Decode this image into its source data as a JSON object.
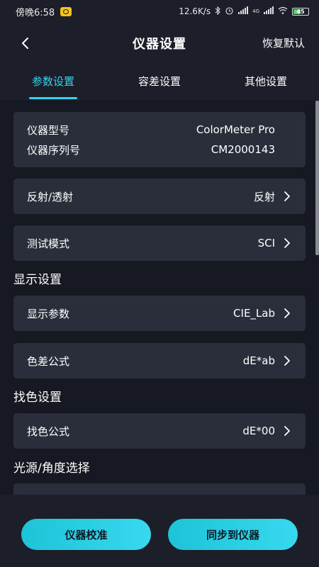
{
  "status_bar": {
    "time": "傍晚6:58",
    "net_speed": "12.6K/s",
    "network": "4G",
    "battery": "45"
  },
  "header": {
    "title": "仪器设置",
    "restore": "恢复默认"
  },
  "tabs": [
    {
      "label": "参数设置",
      "active": true
    },
    {
      "label": "容差设置",
      "active": false
    },
    {
      "label": "其他设置",
      "active": false
    }
  ],
  "device_info": {
    "model_label": "仪器型号",
    "model_value": "ColorMeter Pro",
    "serial_label": "仪器序列号",
    "serial_value": "CM2000143"
  },
  "settings": {
    "reflect_label": "反射/透射",
    "reflect_value": "反射",
    "test_mode_label": "测试模式",
    "test_mode_value": "SCI"
  },
  "display_section": {
    "title": "显示设置",
    "param_label": "显示参数",
    "param_value": "CIE_Lab",
    "formula_label": "色差公式",
    "formula_value": "dE*ab"
  },
  "find_section": {
    "title": "找色设置",
    "formula_label": "找色公式",
    "formula_value": "dE*00"
  },
  "light_section": {
    "title": "光源/角度选择"
  },
  "buttons": {
    "calibrate": "仪器校准",
    "sync": "同步到仪器"
  },
  "colors": {
    "accent": "#2fd6ee",
    "background": "#1c1f29",
    "card": "#2a2e3b"
  }
}
